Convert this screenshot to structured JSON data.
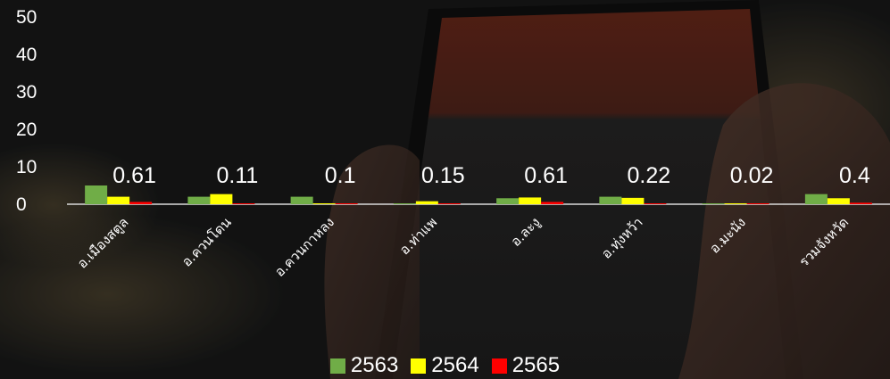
{
  "chart_data": {
    "type": "bar",
    "categories": [
      "อ.เมืองสตูล",
      "อ.ควนโดน",
      "อ.ควนกาหลง",
      "อ.ท่าแพ",
      "อ.ละงู",
      "อ.ทุ่งหว้า",
      "อ.มะนัง",
      "รวมจังหวัด"
    ],
    "series": [
      {
        "name": "2563",
        "color": "#70ad47",
        "values": [
          5.0,
          2.0,
          2.0,
          0.1,
          1.6,
          2.0,
          0.1,
          2.7
        ]
      },
      {
        "name": "2564",
        "color": "#ffff00",
        "values": [
          2.0,
          2.7,
          0.2,
          0.8,
          1.8,
          1.7,
          0.1,
          1.6
        ]
      },
      {
        "name": "2565",
        "color": "#ff0000",
        "values": [
          0.61,
          0.11,
          0.1,
          0.15,
          0.61,
          0.22,
          0.02,
          0.4
        ]
      }
    ],
    "data_labels": [
      "0.61",
      "0.11",
      "0.1",
      "0.15",
      "0.61",
      "0.22",
      "0.02",
      "0.4"
    ],
    "ylim": [
      0,
      50
    ],
    "yticks": [
      "0",
      "10",
      "20",
      "30",
      "40",
      "50"
    ],
    "grid": false,
    "legend": "bottom"
  }
}
